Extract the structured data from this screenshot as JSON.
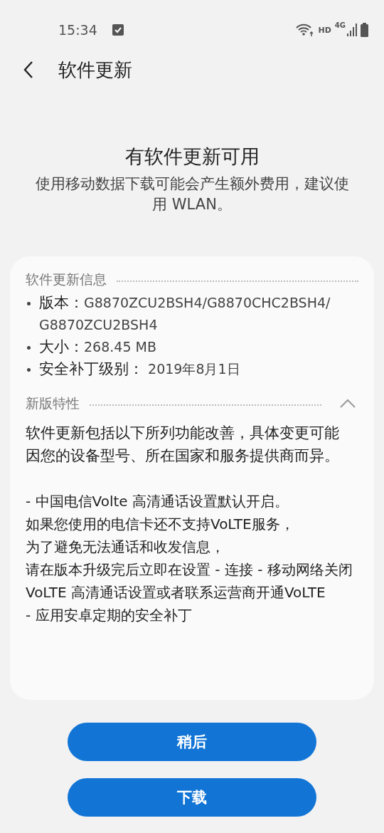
{
  "status_bar": {
    "time": "15:34",
    "hd": "HD",
    "network": "4G"
  },
  "header": {
    "title": "软件更新"
  },
  "intro": {
    "heading": "有软件更新可用",
    "message": "使用移动数据下载可能会产生额外费用，建议使用 WLAN。"
  },
  "info_section": {
    "title": "软件更新信息",
    "items": [
      {
        "label": "版本：",
        "value": "G8870ZCU2BSH4/G8870CHC2BSH4/\nG8870ZCU2BSH4"
      },
      {
        "label": "大小：",
        "value": "268.45 MB"
      },
      {
        "label": "安全补丁级别：",
        "value": " 2019年8月1日"
      }
    ]
  },
  "features_section": {
    "title": "新版特性",
    "expanded": true,
    "summary": "软件更新包括以下所列功能改善，具体变更可能因您的设备型号、所在国家和服务提供商而异。",
    "notes": [
      "- 中国电信Volte 高清通话设置默认开启。",
      "如果您使用的电信卡还不支持VoLTE服务，",
      "为了避免无法通话和收发信息，",
      "请在版本升级完后立即在设置 - 连接 - 移动网络关闭VoLTE 高清通话设置或者联系运营商开通VoLTE",
      "- 应用安卓定期的安全补丁"
    ]
  },
  "buttons": [
    "稍后",
    "下载"
  ]
}
